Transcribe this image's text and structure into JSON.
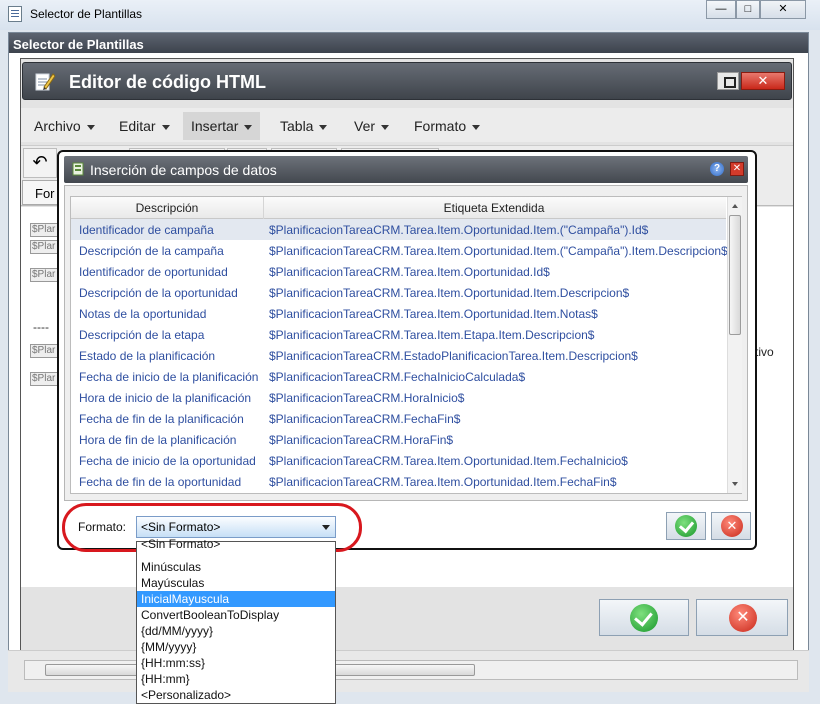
{
  "outer_window": {
    "title": "Selector de Plantillas",
    "subtitle": "Selector de Plantillas",
    "min_glyph": "—",
    "max_glyph": "□",
    "close_glyph": "✕"
  },
  "editor": {
    "title": "Editor de código HTML",
    "close_glyph": "✕",
    "menus": [
      "Archivo",
      "Editar",
      "Insertar",
      "Tabla",
      "Ver",
      "Formato"
    ],
    "selected_menu": "Insertar",
    "undo_glyph": "↶",
    "format_tab": "For",
    "placeholders": [
      "$Plar",
      "$Plar",
      "$Plar",
      "$Plar",
      "$Plar"
    ],
    "dashes": "----",
    "fragment_right": "tivo"
  },
  "dialog": {
    "title": "Inserción de campos de datos",
    "help_glyph": "?",
    "close_glyph": "✕",
    "columns": [
      "Descripción",
      "Etiqueta Extendida"
    ],
    "rows": [
      [
        "Identificador de campaña",
        "$PlanificacionTareaCRM.Tarea.Item.Oportunidad.Item.(\"Campaña\").Id$"
      ],
      [
        "Descripción de la campaña",
        "$PlanificacionTareaCRM.Tarea.Item.Oportunidad.Item.(\"Campaña\").Item.Descripcion$"
      ],
      [
        "Identificador de oportunidad",
        "$PlanificacionTareaCRM.Tarea.Item.Oportunidad.Id$"
      ],
      [
        "Descripción de la oportunidad",
        "$PlanificacionTareaCRM.Tarea.Item.Oportunidad.Item.Descripcion$"
      ],
      [
        "Notas de la oportunidad",
        "$PlanificacionTareaCRM.Tarea.Item.Oportunidad.Item.Notas$"
      ],
      [
        "Descripción de la etapa",
        "$PlanificacionTareaCRM.Tarea.Item.Etapa.Item.Descripcion$"
      ],
      [
        "Estado de la planificación",
        "$PlanificacionTareaCRM.EstadoPlanificacionTarea.Item.Descripcion$"
      ],
      [
        "Fecha de inicio de la planificación",
        "$PlanificacionTareaCRM.FechaInicioCalculada$"
      ],
      [
        "Hora de inicio de la planificación",
        "$PlanificacionTareaCRM.HoraInicio$"
      ],
      [
        "Fecha de fin de la planificación",
        "$PlanificacionTareaCRM.FechaFin$"
      ],
      [
        "Hora de fin de la planificación",
        "$PlanificacionTareaCRM.HoraFin$"
      ],
      [
        "Fecha de inicio de la oportunidad",
        "$PlanificacionTareaCRM.Tarea.Item.Oportunidad.Item.FechaInicio$"
      ],
      [
        "Fecha de fin de la oportunidad",
        "$PlanificacionTareaCRM.Tarea.Item.Oportunidad.Item.FechaFin$"
      ]
    ],
    "selected_row": 0,
    "format_label": "Formato:",
    "format_value": "<Sin Formato>",
    "format_options": [
      "<Sin Formato>",
      "Minúsculas",
      "Mayúsculas",
      "InicialMayuscula",
      "ConvertBooleanToDisplay",
      "{dd/MM/yyyy}",
      "{MM/yyyy}",
      "{HH:mm:ss}",
      "{HH:mm}",
      "<Personalizado>"
    ],
    "highlighted_option": "InicialMayuscula",
    "cancel_glyph": "✕"
  },
  "colors": {
    "accent": "#3399ff",
    "highlight_ring": "#d8181e",
    "link_text": "#2f4fa0"
  }
}
